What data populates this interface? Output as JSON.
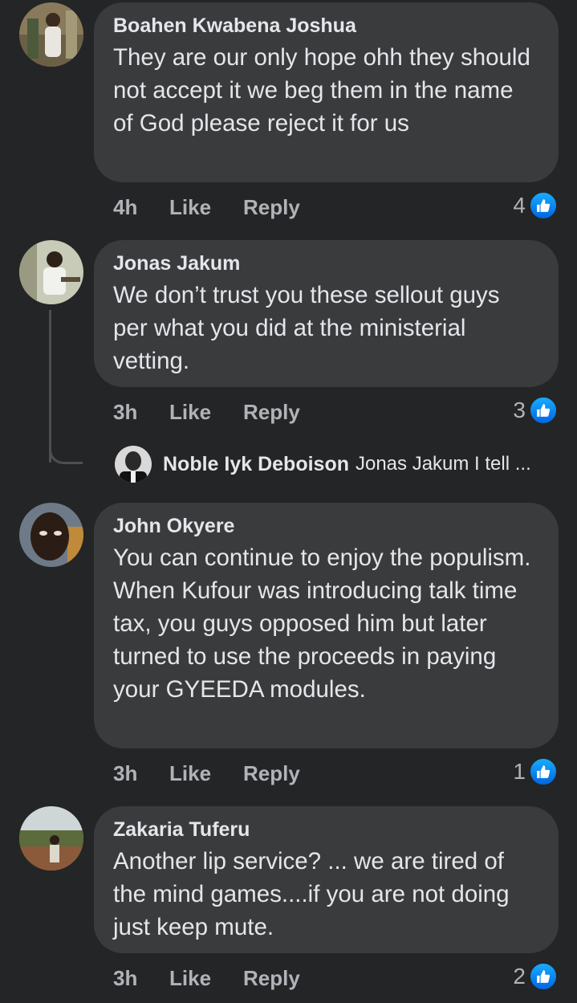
{
  "comments": [
    {
      "author": "Boahen Kwabena Joshua",
      "text": "They are our only hope ohh they should not accept it we beg them in the name of God please reject it for us",
      "time": "4h",
      "like_label": "Like",
      "reply_label": "Reply",
      "reactions": "4"
    },
    {
      "author": "Jonas Jakum",
      "text": "We don’t trust you these sellout guys per what you did at the ministerial vetting.",
      "time": "3h",
      "like_label": "Like",
      "reply_label": "Reply",
      "reactions": "3"
    },
    {
      "author": "John Okyere",
      "text": "You can continue to enjoy the populism. When Kufour was introducing talk time tax, you guys opposed him but later turned to use the proceeds in paying your GYEEDA modules.",
      "time": "3h",
      "like_label": "Like",
      "reply_label": "Reply",
      "reactions": "1"
    },
    {
      "author": "Zakaria Tuferu",
      "text": "Another lip service? ... we are tired of the mind games....if you are not doing just keep mute.",
      "time": "3h",
      "like_label": "Like",
      "reply_label": "Reply",
      "reactions": "2"
    }
  ],
  "reply_preview": {
    "author": "Noble Iyk Deboison",
    "text": "Jonas Jakum I tell ..."
  },
  "colors": {
    "background": "#242526",
    "bubble": "#3a3b3c",
    "primary_text": "#e4e6eb",
    "secondary_text": "#b0b3b8",
    "like_blue": "#0165e1"
  },
  "icons": {
    "reaction": "thumbs-up-icon"
  }
}
